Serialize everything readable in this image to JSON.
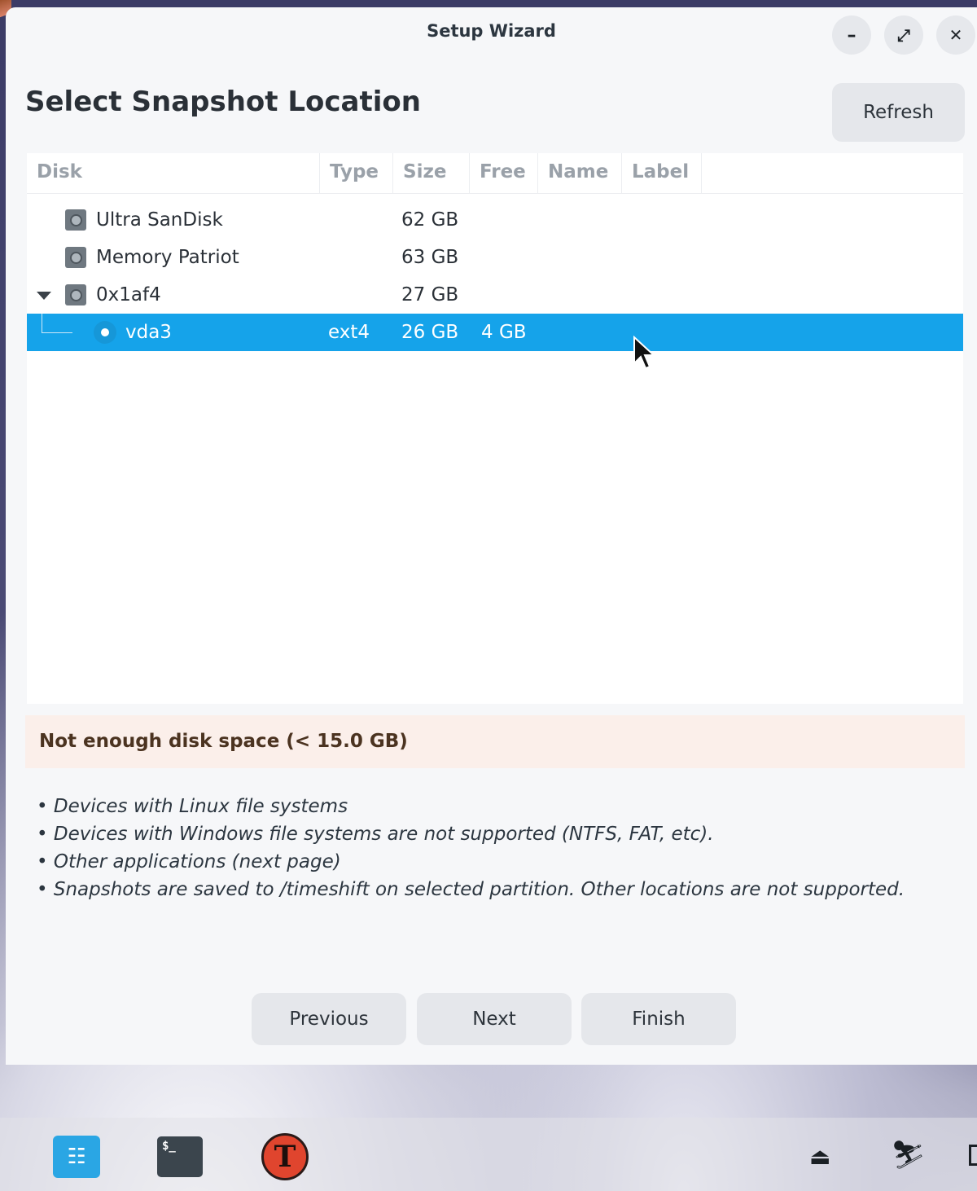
{
  "window": {
    "title": "Setup Wizard",
    "controls": {
      "minimize": "–",
      "maximize": "⤢",
      "close": "✕"
    }
  },
  "page_title": "Select Snapshot Location",
  "refresh_label": "Refresh",
  "table": {
    "columns": [
      "Disk",
      "Type",
      "Size",
      "Free",
      "Name",
      "Label"
    ],
    "rows": [
      {
        "disk": "Ultra SanDisk",
        "type": "",
        "size": "62 GB",
        "free": "",
        "name": "",
        "label": ""
      },
      {
        "disk": "Memory Patriot",
        "type": "",
        "size": "63 GB",
        "free": "",
        "name": "",
        "label": ""
      },
      {
        "disk": "0x1af4",
        "type": "",
        "size": "27 GB",
        "free": "",
        "name": "",
        "label": "",
        "expanded": true
      },
      {
        "disk": "vda3",
        "type": "ext4",
        "size": "26 GB",
        "free": "4 GB",
        "name": "",
        "label": "",
        "selected": true
      }
    ]
  },
  "warning": "Not enough disk space (< 15.0 GB)",
  "notes": [
    "• Devices with Linux file systems",
    "• Devices with Windows file systems are not supported (NTFS, FAT, etc).",
    "• Other applications (next page)",
    "• Snapshots are saved to /timeshift on selected partition. Other locations are not supported."
  ],
  "nav": {
    "previous": "Previous",
    "next": "Next",
    "finish": "Finish"
  },
  "taskbar": {
    "terminal_prompt": "$_",
    "timeshift_glyph": "T",
    "icons": [
      "store-icon",
      "terminal-icon",
      "timeshift-icon",
      "eject-icon",
      "accessibility-icon"
    ]
  },
  "colors": {
    "selection": "#15a3ea",
    "warning_bg": "#fbefea",
    "accent": "#2aa6e4"
  }
}
